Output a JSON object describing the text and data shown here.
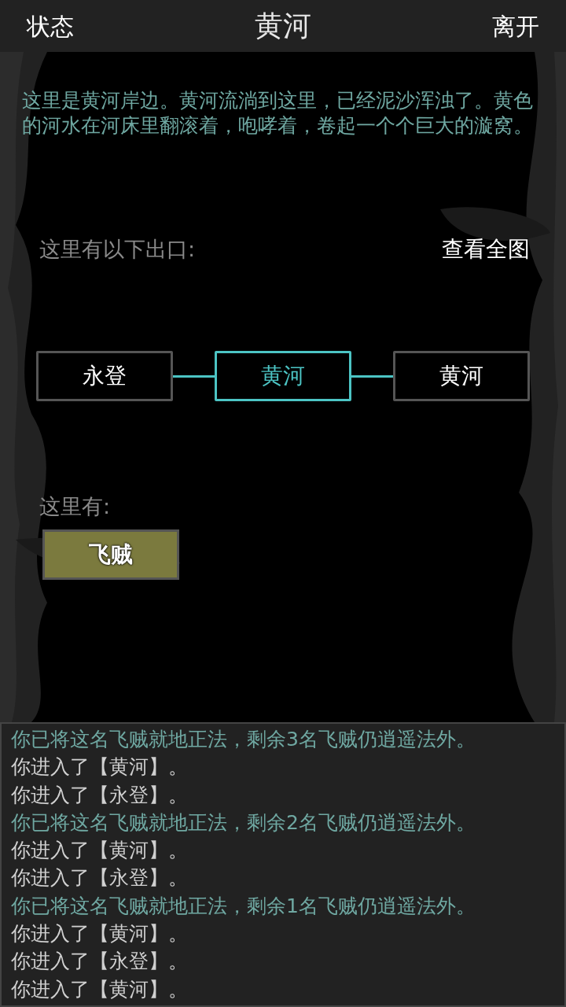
{
  "header": {
    "left_button": "状态",
    "title": "黄河",
    "right_button": "离开"
  },
  "description": "这里是黄河岸边。黄河流淌到这里，已经泥沙浑浊了。黄色的河水在河床里翻滚着，咆哮着，卷起一个个巨大的漩窝。",
  "exits": {
    "label": "这里有以下出口:",
    "map_button": "查看全图",
    "rooms": [
      {
        "name": "永登",
        "selected": false
      },
      {
        "name": "黄河",
        "selected": true
      },
      {
        "name": "黄河",
        "selected": false
      }
    ]
  },
  "present": {
    "label": "这里有:",
    "npcs": [
      "飞贼"
    ]
  },
  "log": [
    {
      "kind": "kill",
      "text": "你已将这名飞贼就地正法，剩余3名飞贼仍逍遥法外。"
    },
    {
      "kind": "move",
      "text": "你进入了【黄河】。"
    },
    {
      "kind": "move",
      "text": "你进入了【永登】。"
    },
    {
      "kind": "kill",
      "text": "你已将这名飞贼就地正法，剩余2名飞贼仍逍遥法外。"
    },
    {
      "kind": "move",
      "text": "你进入了【黄河】。"
    },
    {
      "kind": "move",
      "text": "你进入了【永登】。"
    },
    {
      "kind": "kill",
      "text": "你已将这名飞贼就地正法，剩余1名飞贼仍逍遥法外。"
    },
    {
      "kind": "move",
      "text": "你进入了【黄河】。"
    },
    {
      "kind": "move",
      "text": "你进入了【永登】。"
    },
    {
      "kind": "move",
      "text": "你进入了【黄河】。"
    }
  ]
}
